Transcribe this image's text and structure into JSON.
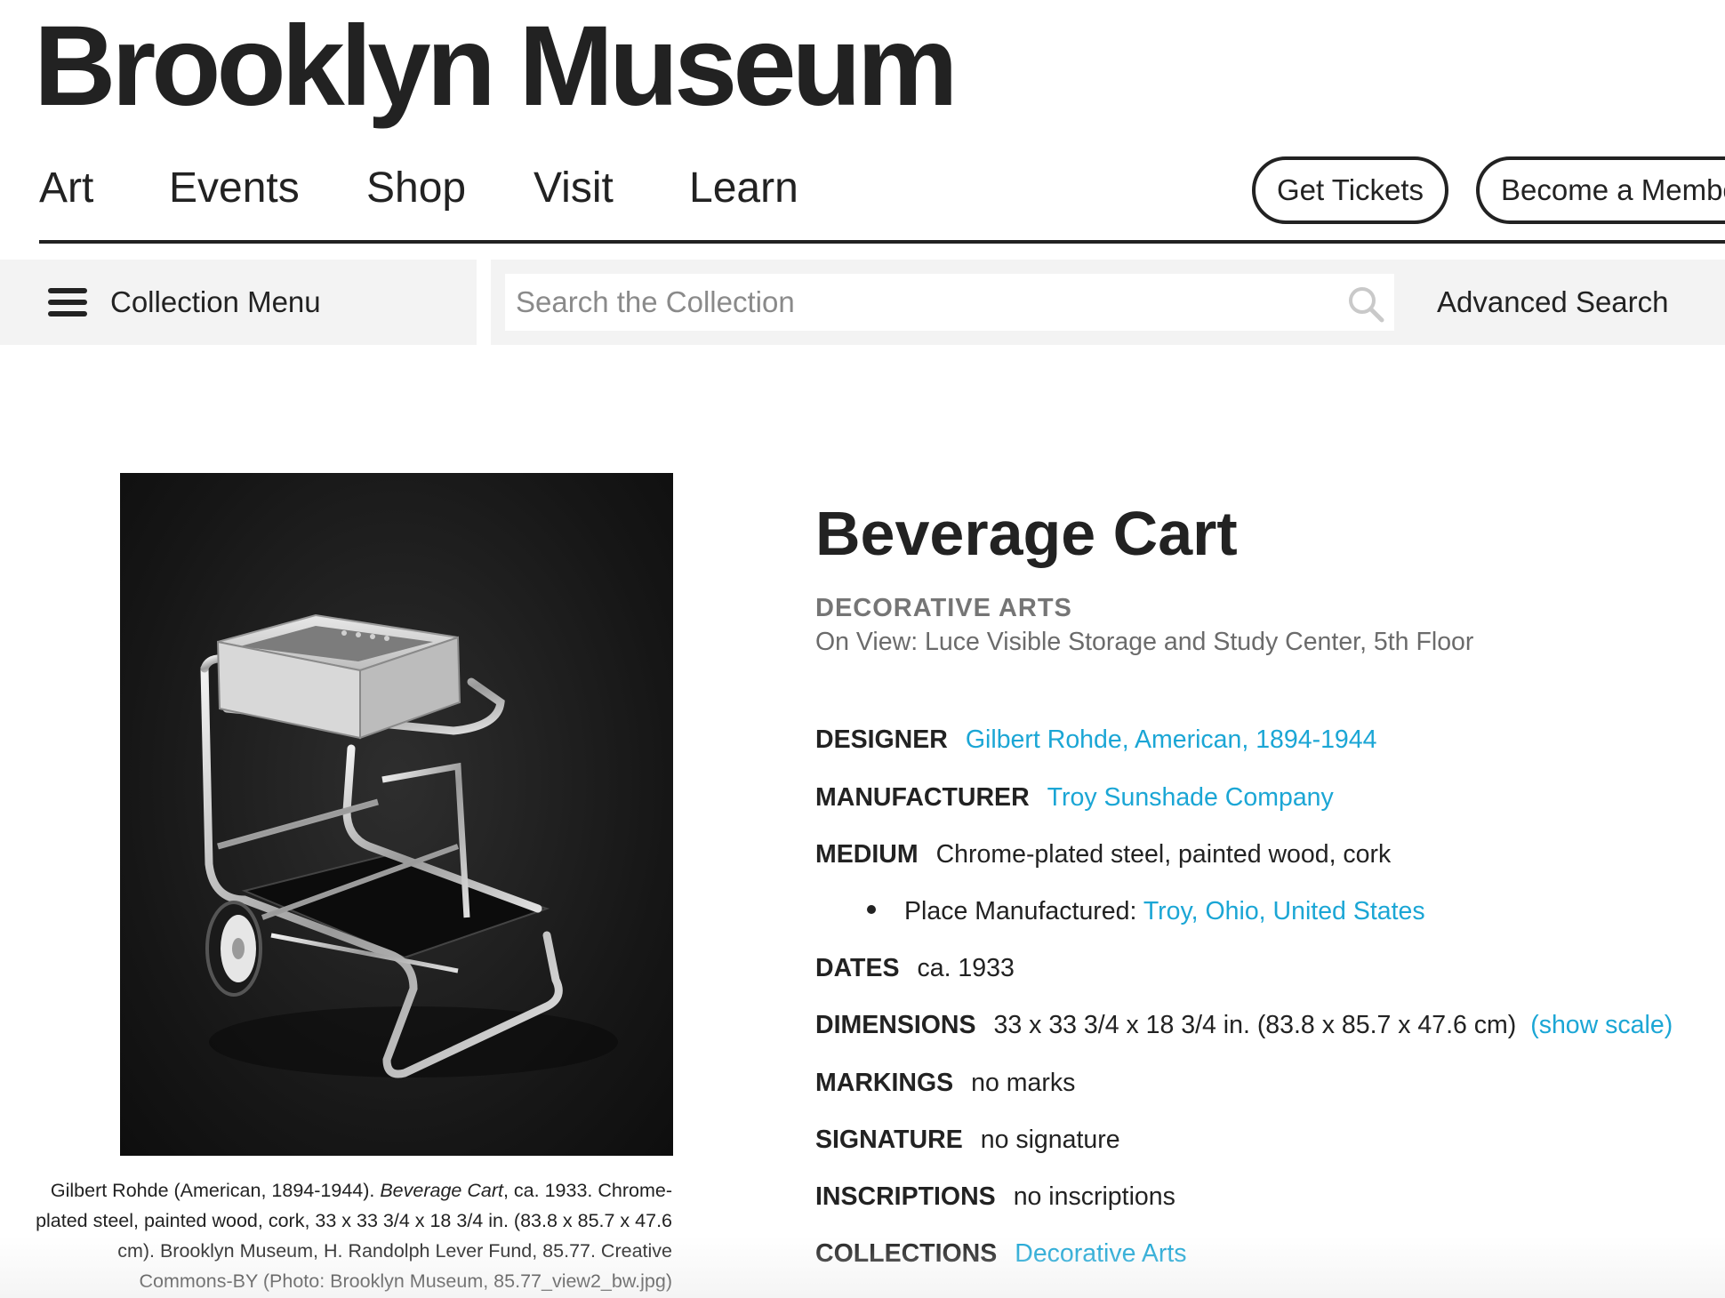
{
  "header": {
    "logo": "Brooklyn Museum",
    "nav": [
      "Art",
      "Events",
      "Shop",
      "Visit",
      "Learn"
    ],
    "tickets_label": "Get Tickets",
    "member_label": "Become a Membe"
  },
  "collection_bar": {
    "menu_label": "Collection Menu",
    "search_placeholder": "Search the Collection",
    "advanced_search_label": "Advanced Search"
  },
  "artwork": {
    "image_alt": "Beverage Cart",
    "caption": {
      "before": "Gilbert Rohde (American, 1894-1944). ",
      "title": "Beverage Cart",
      "after": ", ca. 1933. Chrome-plated steel, painted wood, cork, 33 x 33 3/4 x 18 3/4 in. (83.8 x 85.7 x 47.6 cm). Brooklyn Museum, H. Randolph Lever Fund, 85.77. Creative Commons-BY (Photo: Brooklyn Museum, 85.77_view2_bw.jpg)"
    }
  },
  "object": {
    "title": "Beverage Cart",
    "department": "DECORATIVE ARTS",
    "on_view": "On View: Luce Visible Storage and Study Center, 5th Floor",
    "fields": {
      "designer": {
        "label": "DESIGNER",
        "value": "Gilbert Rohde, American, 1894-1944"
      },
      "manufacturer": {
        "label": "MANUFACTURER",
        "value": "Troy Sunshade Company"
      },
      "medium": {
        "label": "MEDIUM",
        "value": "Chrome-plated steel, painted wood, cork"
      },
      "place_manufactured": {
        "label": "Place Manufactured:",
        "value": "Troy, Ohio, United States"
      },
      "dates": {
        "label": "DATES",
        "value": "ca. 1933"
      },
      "dimensions": {
        "label": "DIMENSIONS",
        "value": "33 x 33 3/4 x 18 3/4 in. (83.8 x 85.7 x 47.6 cm)",
        "link": "(show scale)"
      },
      "markings": {
        "label": "MARKINGS",
        "value": "no marks"
      },
      "signature": {
        "label": "SIGNATURE",
        "value": "no signature"
      },
      "inscriptions": {
        "label": "INSCRIPTIONS",
        "value": "no inscriptions"
      },
      "collections": {
        "label": "COLLECTIONS",
        "value": "Decorative Arts"
      }
    }
  },
  "colors": {
    "text": "#222222",
    "link": "#1ba6d5",
    "muted": "#757575",
    "bar_background": "#f3f3f3"
  }
}
